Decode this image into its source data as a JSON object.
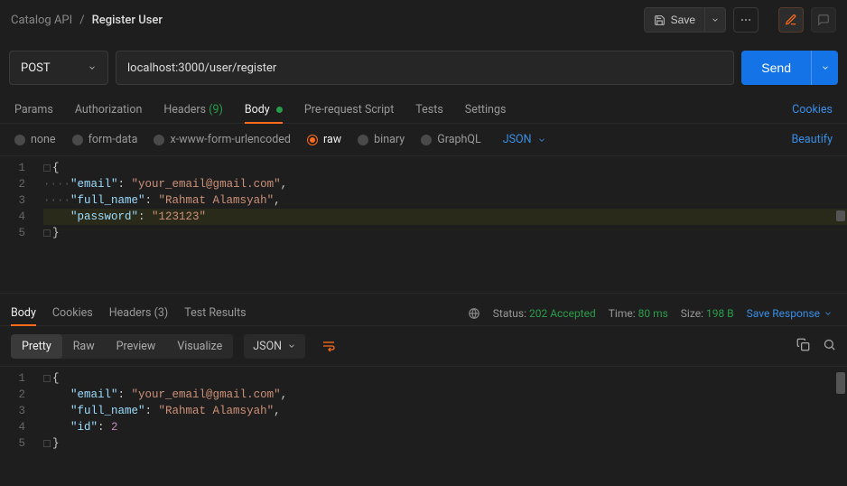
{
  "breadcrumb": {
    "parent": "Catalog API",
    "sep": "/",
    "current": "Register User"
  },
  "toolbar": {
    "save": "Save"
  },
  "request": {
    "method": "POST",
    "url": "localhost:3000/user/register",
    "send": "Send"
  },
  "req_tabs": {
    "params": "Params",
    "auth": "Authorization",
    "headers": "Headers",
    "headers_count": "(9)",
    "body": "Body",
    "prereq": "Pre-request Script",
    "tests": "Tests",
    "settings": "Settings",
    "cookies": "Cookies"
  },
  "body_types": {
    "none": "none",
    "formdata": "form-data",
    "urlencoded": "x-www-form-urlencoded",
    "raw": "raw",
    "binary": "binary",
    "graphql": "GraphQL",
    "lang": "JSON",
    "beautify": "Beautify"
  },
  "request_body_lines": [
    {
      "n": 1,
      "tokens": [
        {
          "c": "fold",
          "t": ""
        },
        {
          "c": "pun",
          "t": "{"
        }
      ]
    },
    {
      "n": 2,
      "tokens": [
        {
          "c": "wsdot",
          "t": "····"
        },
        {
          "c": "key",
          "t": "\"email\""
        },
        {
          "c": "pun",
          "t": ": "
        },
        {
          "c": "str",
          "t": "\"your_email@gmail.com\""
        },
        {
          "c": "pun",
          "t": ","
        }
      ]
    },
    {
      "n": 3,
      "tokens": [
        {
          "c": "wsdot",
          "t": "····"
        },
        {
          "c": "key",
          "t": "\"full_name\""
        },
        {
          "c": "pun",
          "t": ": "
        },
        {
          "c": "str",
          "t": "\"Rahmat Alamsyah\""
        },
        {
          "c": "pun",
          "t": ","
        }
      ]
    },
    {
      "n": 4,
      "hl": true,
      "tokens": [
        {
          "c": "wsdot",
          "t": "    "
        },
        {
          "c": "key",
          "t": "\"password\""
        },
        {
          "c": "pun",
          "t": ": "
        },
        {
          "c": "str",
          "t": "\"123123\""
        }
      ]
    },
    {
      "n": 5,
      "tokens": [
        {
          "c": "fold",
          "t": ""
        },
        {
          "c": "pun",
          "t": "}"
        }
      ]
    }
  ],
  "resp_tabs": {
    "body": "Body",
    "cookies": "Cookies",
    "headers": "Headers",
    "headers_count": "(3)",
    "results": "Test Results"
  },
  "resp_meta": {
    "status_label": "Status:",
    "status_code": "202",
    "status_text": "Accepted",
    "time_label": "Time:",
    "time_value": "80 ms",
    "size_label": "Size:",
    "size_value": "198 B",
    "save_response": "Save Response"
  },
  "resp_view": {
    "pretty": "Pretty",
    "raw": "Raw",
    "preview": "Preview",
    "visualize": "Visualize",
    "lang": "JSON"
  },
  "response_body_lines": [
    {
      "n": 1,
      "tokens": [
        {
          "c": "fold",
          "t": ""
        },
        {
          "c": "pun",
          "t": "{"
        }
      ]
    },
    {
      "n": 2,
      "tokens": [
        {
          "c": "wsdot",
          "t": "    "
        },
        {
          "c": "key",
          "t": "\"email\""
        },
        {
          "c": "pun",
          "t": ": "
        },
        {
          "c": "str",
          "t": "\"your_email@gmail.com\""
        },
        {
          "c": "pun",
          "t": ","
        }
      ]
    },
    {
      "n": 3,
      "tokens": [
        {
          "c": "wsdot",
          "t": "    "
        },
        {
          "c": "key",
          "t": "\"full_name\""
        },
        {
          "c": "pun",
          "t": ": "
        },
        {
          "c": "str",
          "t": "\"Rahmat Alamsyah\""
        },
        {
          "c": "pun",
          "t": ","
        }
      ]
    },
    {
      "n": 4,
      "tokens": [
        {
          "c": "wsdot",
          "t": "    "
        },
        {
          "c": "key",
          "t": "\"id\""
        },
        {
          "c": "pun",
          "t": ": "
        },
        {
          "c": "num",
          "t": "2"
        }
      ]
    },
    {
      "n": 5,
      "tokens": [
        {
          "c": "fold",
          "t": ""
        },
        {
          "c": "pun",
          "t": "}"
        }
      ]
    }
  ]
}
